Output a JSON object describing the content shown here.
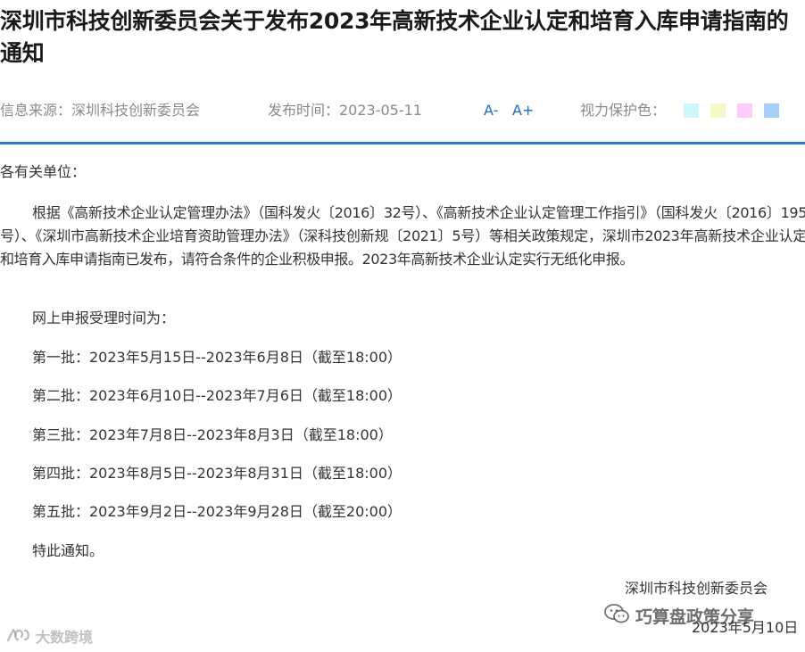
{
  "article": {
    "title": "深圳市科技创新委员会关于发布2023年高新技术企业认定和培育入库申请指南的通知",
    "source_label": "信息来源：深圳科技创新委员会",
    "publish_label": "发布时间：2023-05-11",
    "font_decrease": "A-",
    "font_increase": "A+",
    "eye_protection_label": "视力保护色：",
    "eye_colors": [
      "#ccf8fb",
      "#f8f7c7",
      "#fbcef8",
      "#a7cef8"
    ],
    "accent_color": "#2f7bd0"
  },
  "content": {
    "salutation": "各有关单位：",
    "paragraph": "根据《高新技术企业认定管理办法》（国科发火〔2016〕32号）、《高新技术企业认定管理工作指引》（国科发火〔2016〕195号）、《深圳市高新技术企业培育资助管理办法》（深科技创新规〔2021〕5号）等相关政策规定，深圳市2023年高新技术企业认定和培育入库申请指南已发布，请符合条件的企业积极申报。2023年高新技术企业认定实行无纸化申报。",
    "online_time_label": "网上申报受理时间为：",
    "batches": [
      "第一批：2023年5月15日--2023年6月8日（截至18:00）",
      "第二批：2023年6月10日--2023年7月6日（截至18:00）",
      "第三批：2023年7月8日--2023年8月3日（截至18:00）",
      "第四批：2023年8月5日--2023年8月31日（截至18:00）",
      "第五批：2023年9月2日--2023年9月28日（截至20:00）"
    ],
    "closing": "特此通知。",
    "signature_org": "深圳市科技创新委员会",
    "signature_date": "2023年5月10日"
  },
  "watermarks": {
    "right_text": "巧算盘政策分享",
    "right_icon": "wechat-icon",
    "left_text": "大数跨境",
    "left_icon": "dashu-logo-icon"
  }
}
